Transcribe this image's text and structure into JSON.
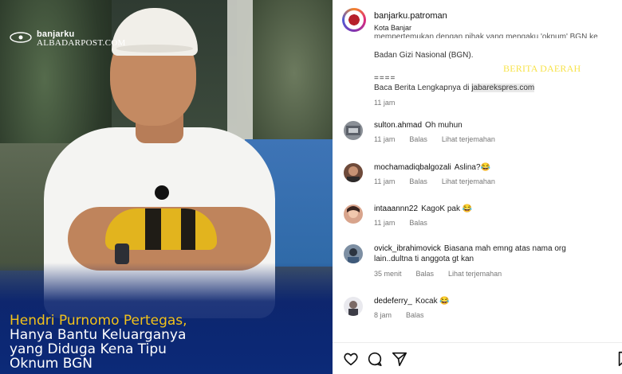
{
  "photo": {
    "logo": {
      "line1": "banjarku",
      "line2": "ALBADARPOST.COM"
    },
    "headline": {
      "line1": "Hendri Purnomo Pertegas,",
      "line2": "Hanya Bantu Keluarganya",
      "line3": "yang Diduga Kena Tipu",
      "line4": "Oknum BGN"
    },
    "colors": {
      "headline_accent": "#f2c21b",
      "panel_blue": "#0c2a78"
    }
  },
  "instagram": {
    "account": {
      "username": "banjarku.patroman",
      "location": "Kota Banjar"
    },
    "caption": {
      "cut_line": "mempertemukan dengan pihak yang mengaku 'oknum' BGN ke",
      "line_bgn": "Badan Gizi Nasional (BGN).",
      "separator": "====",
      "read_more_prefix": "Baca Berita Lengkapnya di",
      "read_more_link": "jabarekspres.com",
      "time": "11 jam"
    },
    "watermark": "BERITA DAERAH",
    "comments": [
      {
        "user": "sulton.ahmad",
        "text": "Oh muhun",
        "time": "11 jam",
        "reply": "Balas",
        "translate": "Lihat terjemahan"
      },
      {
        "user": "mochamadiqbalgozali",
        "text": "Aslina?😂",
        "time": "11 jam",
        "reply": "Balas",
        "translate": "Lihat terjemahan"
      },
      {
        "user": "intaaannn22",
        "text": "KagoK pak 😂",
        "time": "11 jam",
        "reply": "Balas"
      },
      {
        "user": "ovick_ibrahimovick",
        "text": "Biasana mah emng atas nama org",
        "text2": "lain..dultna ti anggota gt kan",
        "time": "35 menit",
        "reply": "Balas",
        "translate": "Lihat terjemahan"
      },
      {
        "user": "dedeferry_",
        "text": "Kocak 😂",
        "time": "8 jam",
        "reply": "Balas"
      }
    ],
    "actions": [
      "heart-icon",
      "comment-icon",
      "share-icon",
      "bookmark-icon"
    ]
  }
}
